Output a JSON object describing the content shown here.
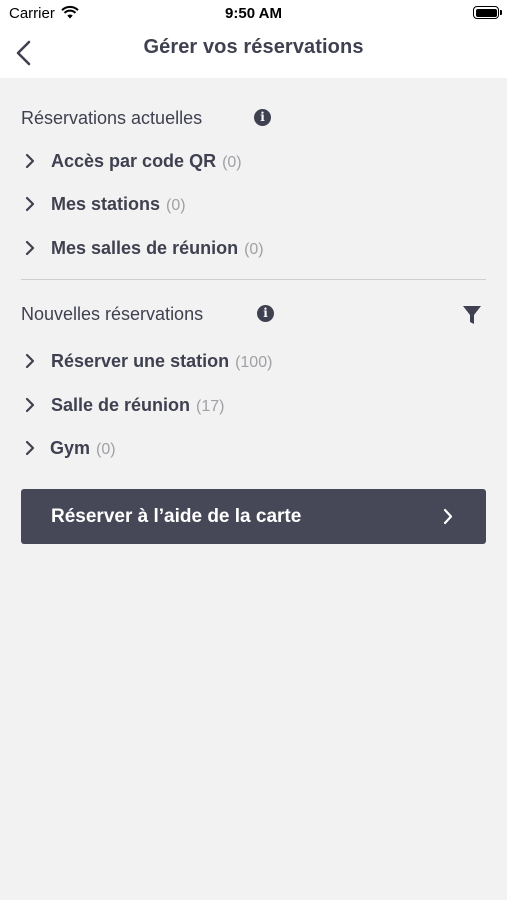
{
  "status_bar": {
    "carrier": "Carrier",
    "time": "9:50 AM"
  },
  "nav": {
    "title": "Gérer vos réservations"
  },
  "current_reservations": {
    "title": "Réservations actuelles",
    "items": [
      {
        "label": "Accès par code QR",
        "count": "(0)"
      },
      {
        "label": "Mes stations",
        "count": "(0)"
      },
      {
        "label": "Mes salles de réunion",
        "count": "(0)"
      }
    ]
  },
  "new_reservations": {
    "title": "Nouvelles réservations",
    "items": [
      {
        "label": "Réserver une station",
        "count": "(100)"
      },
      {
        "label": "Salle de réunion",
        "count": "(17)"
      },
      {
        "label": "Gym",
        "count": "(0)"
      }
    ]
  },
  "map_button": {
    "label": "Réserver à l’aide de la carte"
  },
  "colors": {
    "primary_text": "#3f4150",
    "muted_text": "#a0a0a5",
    "button_bg": "#474857",
    "background": "#f2f2f2"
  }
}
